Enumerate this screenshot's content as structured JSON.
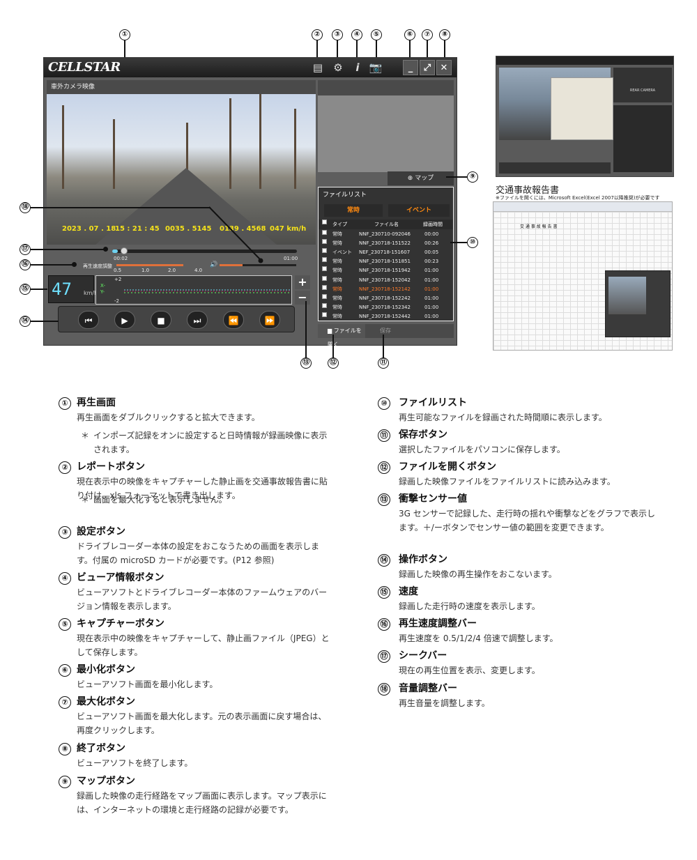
{
  "viewer": {
    "logo": "CELLSTAR",
    "cam_label": "車外カメラ映像",
    "overlay": {
      "date": "2023 . 07 . 18",
      "time": "15 : 21 : 45",
      "lat": "0035 . 5145",
      "lon": "0139 . 4568",
      "speed": "047 km/h"
    },
    "seek_start": "00:02",
    "seek_end": "01:00",
    "seek_fraction": 0.03,
    "speed_label": "再生速度調整",
    "speed_ticks": [
      "0.5",
      "1.0",
      "2.0",
      "4.0"
    ],
    "vol_fraction": 0.3,
    "speed_display": "47",
    "speed_unit": "km/h",
    "graph_axis": [
      "+2",
      "X-",
      "Y-",
      "-2"
    ],
    "plus": "+",
    "minus": "−",
    "map_button": "マップ",
    "open_button": "ファイルを開く",
    "save_button": "保存"
  },
  "filelist": {
    "title": "ファイルリスト",
    "tab_normal": "常時",
    "tab_event": "イベント",
    "headers": [
      "タイプ",
      "ファイル名",
      "録画時間"
    ],
    "rows": [
      {
        "type": "常時",
        "name": "NNF_230710-092046",
        "time": "00:00",
        "highlight": false
      },
      {
        "type": "常時",
        "name": "NNF_230718-151522",
        "time": "00:26",
        "highlight": false
      },
      {
        "type": "イベント",
        "name": "NEF_230718-151607",
        "time": "00:05",
        "highlight": false
      },
      {
        "type": "常時",
        "name": "NNF_230718-151851",
        "time": "00:23",
        "highlight": false
      },
      {
        "type": "常時",
        "name": "NNF_230718-151942",
        "time": "01:00",
        "highlight": false
      },
      {
        "type": "常時",
        "name": "NNF_230718-152042",
        "time": "01:00",
        "highlight": false
      },
      {
        "type": "常時",
        "name": "NNF_230718-152142",
        "time": "01:00",
        "highlight": true
      },
      {
        "type": "常時",
        "name": "NNF_230718-152242",
        "time": "01:00",
        "highlight": false
      },
      {
        "type": "常時",
        "name": "NNF_230718-152342",
        "time": "01:00",
        "highlight": false
      },
      {
        "type": "常時",
        "name": "NNF_230718-152442",
        "time": "01:00",
        "highlight": false
      }
    ]
  },
  "callouts": [
    "①",
    "②",
    "③",
    "④",
    "⑤",
    "⑥",
    "⑦",
    "⑧",
    "⑨",
    "⑩",
    "⑪",
    "⑫",
    "⑬",
    "⑭",
    "⑮",
    "⑯",
    "⑰",
    "⑱"
  ],
  "report": {
    "title": "交通事故報告書",
    "note": "※ファイルを開くには、Microsoft Excel(Excel 2007以降推奨)が必要です",
    "sheet_title": "交 通 事 故 報 告 書",
    "thumb_label": "REAR CAMERA"
  },
  "items": [
    {
      "num": "①",
      "title": "再生画面",
      "body": "再生画面をダブルクリックすると拡大できます。",
      "note": "インポーズ記録をオンに設定すると日時情報が録画映像に表示されます。"
    },
    {
      "num": "②",
      "title": "レポートボタン",
      "body": "現在表示中の映像をキャプチャーした静止画を交通事故報告書に貼り付け、xls フォーマットで書き出します。",
      "note": "画面を最大化すると表示しません。"
    },
    {
      "num": "③",
      "title": "設定ボタン",
      "body": "ドライブレコーダー本体の設定をおこなうための画面を表示します。付属の microSD カードが必要です。(P12 参照)"
    },
    {
      "num": "④",
      "title": "ビューア情報ボタン",
      "body": "ビューアソフトとドライブレコーダー本体のファームウェアのバージョン情報を表示します。"
    },
    {
      "num": "⑤",
      "title": "キャプチャーボタン",
      "body": "現在表示中の映像をキャプチャーして、静止画ファイル（JPEG）として保存します。"
    },
    {
      "num": "⑥",
      "title": "最小化ボタン",
      "body": "ビューアソフト画面を最小化します。"
    },
    {
      "num": "⑦",
      "title": "最大化ボタン",
      "body": "ビューアソフト画面を最大化します。元の表示画面に戻す場合は、再度クリックします。"
    },
    {
      "num": "⑧",
      "title": "終了ボタン",
      "body": "ビューアソフトを終了します。"
    },
    {
      "num": "⑨",
      "title": "マップボタン",
      "body": "録画した映像の走行経路をマップ画面に表示します。マップ表示には、インターネットの環境と走行経路の記録が必要です。"
    },
    {
      "num": "⑩",
      "title": "ファイルリスト",
      "body": "再生可能なファイルを録画された時間順に表示します。"
    },
    {
      "num": "⑪",
      "title": "保存ボタン",
      "body": "選択したファイルをパソコンに保存します。"
    },
    {
      "num": "⑫",
      "title": "ファイルを開くボタン",
      "body": "録画した映像ファイルをファイルリストに読み込みます。"
    },
    {
      "num": "⑬",
      "title": "衝撃センサー値",
      "body": "3G センサーで記録した、走行時の揺れや衝撃などをグラフで表示します。＋/ーボタンでセンサー値の範囲を変更できます。"
    },
    {
      "num": "⑭",
      "title": "操作ボタン",
      "body": "録画した映像の再生操作をおこないます。"
    },
    {
      "num": "⑮",
      "title": "速度",
      "body": "録画した走行時の速度を表示します。"
    },
    {
      "num": "⑯",
      "title": "再生速度調整バー",
      "body": "再生速度を 0.5/1/2/4 倍速で調整します。"
    },
    {
      "num": "⑰",
      "title": "シークバー",
      "body": "現在の再生位置を表示、変更します。"
    },
    {
      "num": "⑱",
      "title": "音量調整バー",
      "body": "再生音量を調整します。"
    }
  ]
}
